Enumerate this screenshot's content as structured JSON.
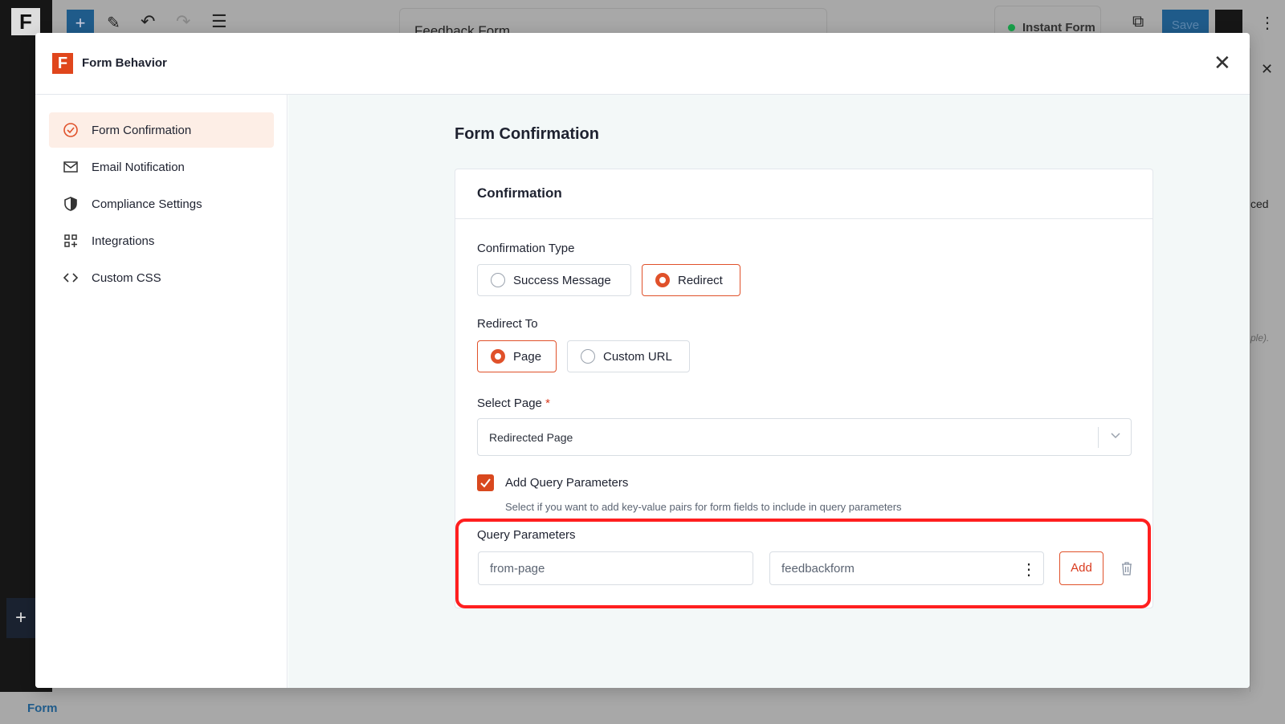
{
  "editor": {
    "form_title": "Feedback Form",
    "instant_form_label": "Instant Form",
    "save_label": "Save",
    "bottom_label": "Form",
    "side_partial": "ced",
    "side_partial2": "ple)."
  },
  "modal": {
    "title": "Form Behavior",
    "nav": [
      {
        "label": "Form Confirmation",
        "icon": "check-circle-icon",
        "active": true
      },
      {
        "label": "Email Notification",
        "icon": "mail-icon"
      },
      {
        "label": "Compliance Settings",
        "icon": "shield-icon"
      },
      {
        "label": "Integrations",
        "icon": "grid-plus-icon"
      },
      {
        "label": "Custom CSS",
        "icon": "code-icon"
      }
    ],
    "main": {
      "title": "Form Confirmation",
      "card_title": "Confirmation",
      "confirmation_type": {
        "label": "Confirmation Type",
        "options": [
          "Success Message",
          "Redirect"
        ],
        "selected": "Redirect"
      },
      "redirect_to": {
        "label": "Redirect To",
        "options": [
          "Page",
          "Custom URL"
        ],
        "selected": "Page"
      },
      "select_page": {
        "label": "Select Page",
        "required": "*",
        "value": "Redirected Page"
      },
      "query_checkbox": {
        "label": "Add Query Parameters",
        "checked": true,
        "help": "Select if you want to add key-value pairs for form fields to include in query parameters"
      },
      "query_params": {
        "label": "Query Parameters",
        "key": "from-page",
        "value": "feedbackform",
        "add_label": "Add"
      }
    }
  },
  "colors": {
    "accent": "#e0512a",
    "highlight": "#ff1f1f"
  }
}
